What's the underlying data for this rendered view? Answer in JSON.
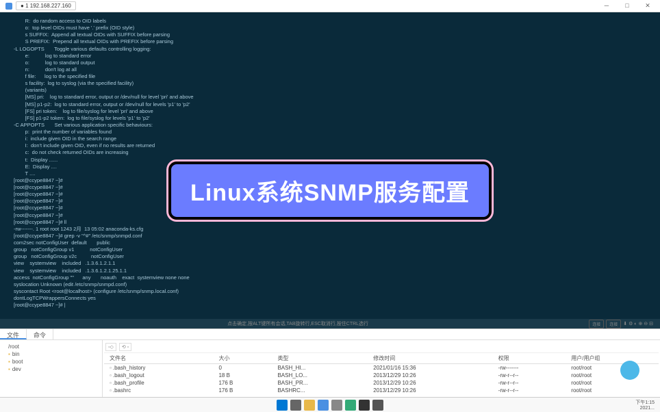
{
  "titlebar": {
    "tab_prefix": "●",
    "address": "1 192.168.227.160"
  },
  "terminal": {
    "lines": [
      "        R:  do random access to OID labels",
      "        o:  top level OIDs must have '.' prefix (OID style)",
      "        s SUFFIX:  Append all textual OIDs with SUFFIX before parsing",
      "        S PREFIX:  Prepend all textual OIDs with PREFIX before parsing",
      "-L LOGOPTS       Toggle various defaults controlling logging:",
      "        e:           log to standard error",
      "        o:           log to standard output",
      "        n:           don't log at all",
      "        f file:      log to the specified file",
      "        s facility:  log to syslog (via the specified facility)",
      "",
      "        (variants)",
      "        [MS] pri:    log to standard error, output or /dev/null for level 'pri' and above",
      "        [MS] p1-p2:  log to standard error, output or /dev/null for levels 'p1' to 'p2'",
      "        [FS] pri token:    log to file/syslog for level 'pri' and above",
      "        [FS] p1-p2 token:  log to file/syslog for levels 'p1' to 'p2'",
      "-C APPOPTS       Set various application specific behaviours:",
      "        p:  print the number of variables found",
      "        i:  include given OID in the search range",
      "        I:  don't include given OID, even if no results are returned",
      "        c:  do not check returned OIDs are increasing",
      "        t:  Display ......",
      "        E:  Display ....",
      "        T ....",
      "[root@ccype8847 ~]#",
      "[root@ccype8847 ~]#",
      "[root@ccype8847 ~]#",
      "[root@ccype8847 ~]#",
      "[root@ccype8847 ~]#",
      "[root@ccype8847 ~]#",
      "[root@ccype8847 ~]# ll",
      "",
      "-rw-------. 1 root root 1243 2月  13 05:02 anaconda-ks.cfg",
      "[root@ccype8847 ~]# grep -v \"^#\" /etc/snmp/snmpd.conf",
      "com2sec notConfigUser  default       public",
      "",
      "group   notConfigGroup v1           notConfigUser",
      "group   notConfigGroup v2c          notConfigUser",
      "view    systemview    included   .1.3.6.1.2.1.1",
      "view    systemview    included   .1.3.6.1.2.1.25.1.1",
      "access  notConfigGroup \"\"      any       noauth    exact  systemview none none",
      "syslocation Unknown (edit /etc/snmp/snmpd.conf)",
      "syscontact Root <root@localhost> (configure /etc/snmp/snmp.local.conf)",
      "",
      "dontLogTCPWrappersConnects yes",
      "[root@ccype8847 ~]# |"
    ]
  },
  "statusbar": {
    "hint": "点击确定,按ALT键所有会话,TAB旋转行,ESC取消行,按住CTRL选行",
    "btn1": "连接",
    "btn2": "连接"
  },
  "banner": {
    "text": "Linux系统SNMP服务配置"
  },
  "panel": {
    "tab1": "文件",
    "tab2": "命令",
    "path": "/root",
    "tree": [
      "bin",
      "boot",
      "dev"
    ],
    "columns": [
      "文件名",
      "大小",
      "类型",
      "修改时间",
      "权限",
      "用户/用户组"
    ],
    "rows": [
      {
        "name": ".bash_history",
        "size": "0",
        "type": "BASH_HI...",
        "date": "2021/01/16 15:36",
        "perm": "-rw-------",
        "owner": "root/root"
      },
      {
        "name": ".bash_logout",
        "size": "18 B",
        "type": "BASH_LO...",
        "date": "2013/12/29 10:26",
        "perm": "-rw-r--r--",
        "owner": "root/root"
      },
      {
        "name": ".bash_profile",
        "size": "176 B",
        "type": "BASH_PR...",
        "date": "2013/12/29 10:26",
        "perm": "-rw-r--r--",
        "owner": "root/root"
      },
      {
        "name": ".bashrc",
        "size": "176 B",
        "type": "BASHRC...",
        "date": "2013/12/29 10:26",
        "perm": "-rw-r--r--",
        "owner": "root/root"
      }
    ]
  },
  "taskbar": {
    "time": "下午1:15",
    "date": "2021..."
  }
}
